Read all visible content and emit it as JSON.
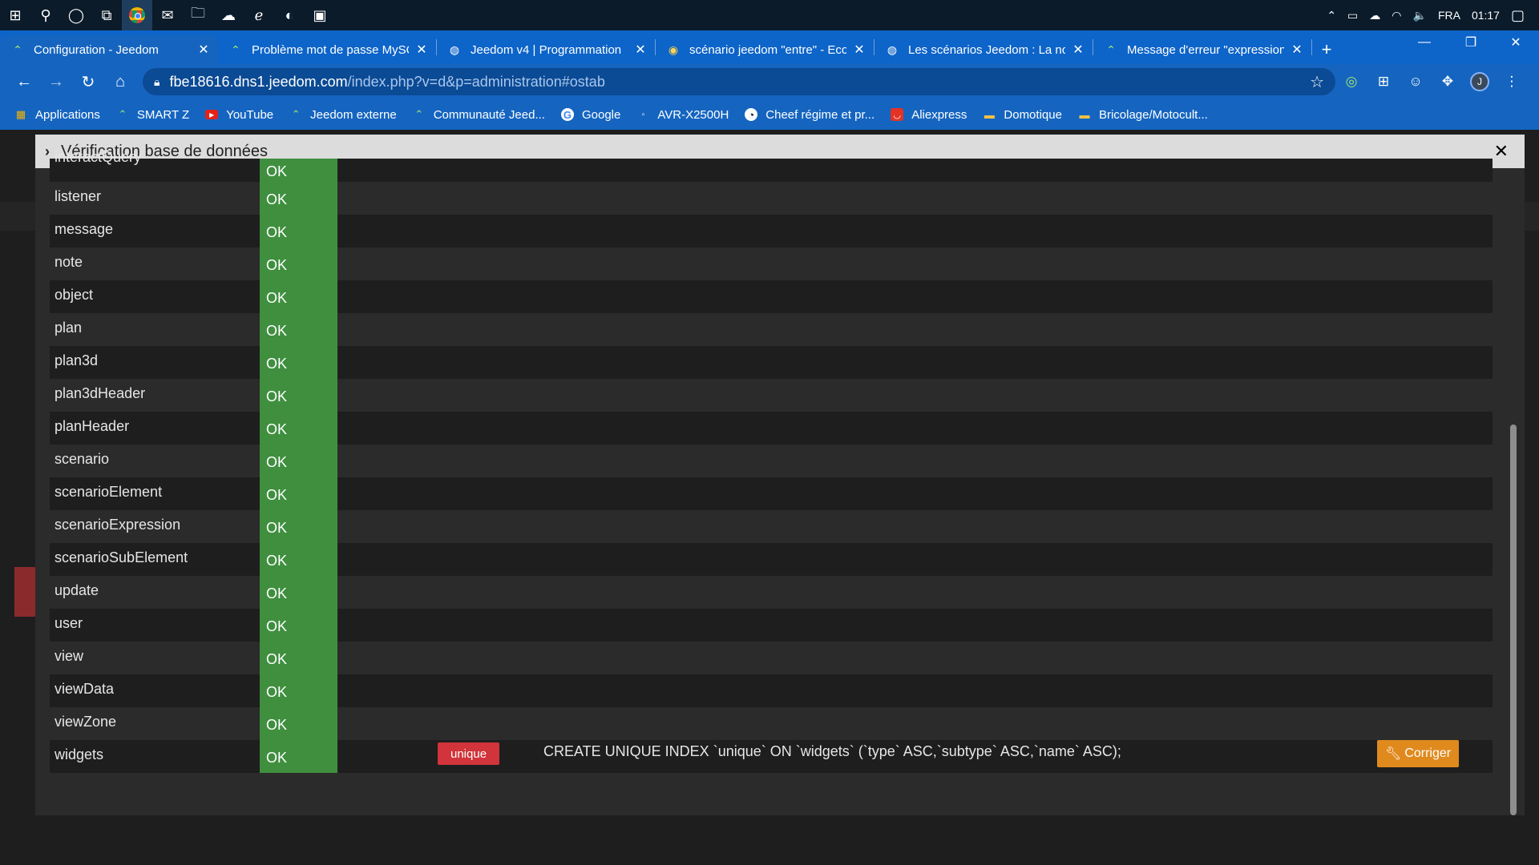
{
  "taskbar": {
    "tray": {
      "language": "FRA",
      "time": "01:17"
    }
  },
  "tabs": [
    {
      "title": "Configuration - Jeedom",
      "icon": "jeedom-icon",
      "active": true
    },
    {
      "title": "Problème mot de passe MySQL",
      "icon": "jeedom-icon"
    },
    {
      "title": "Jeedom v4 | Programmation",
      "icon": "globe-icon"
    },
    {
      "title": "scénario jeedom \"entre\" - Ecosia",
      "icon": "ecosia-icon"
    },
    {
      "title": "Les scénarios Jeedom : La nouvelle",
      "icon": "globe-icon"
    },
    {
      "title": "Message d'erreur \"expression\"",
      "icon": "jeedom-icon"
    }
  ],
  "address": {
    "host": "fbe18616.dns1.jeedom.com",
    "path": "/index.php?v=d&p=administration#ostab"
  },
  "bookmarks": [
    {
      "label": "Applications",
      "icon": "apps-grid-icon"
    },
    {
      "label": "SMART Z",
      "icon": "jeedom-icon"
    },
    {
      "label": "YouTube",
      "icon": "youtube-icon"
    },
    {
      "label": "Jeedom externe",
      "icon": "jeedom-icon"
    },
    {
      "label": "Communauté Jeed...",
      "icon": "jeedom-icon"
    },
    {
      "label": "Google",
      "icon": "google-icon"
    },
    {
      "label": "AVR-X2500H",
      "icon": "denon-icon"
    },
    {
      "label": "Cheef régime et pr...",
      "icon": "cheef-icon"
    },
    {
      "label": "Aliexpress",
      "icon": "aliexpress-icon"
    },
    {
      "label": "Domotique",
      "icon": "folder-icon"
    },
    {
      "label": "Bricolage/Motocult...",
      "icon": "folder-icon"
    }
  ],
  "modal": {
    "title": "Vérification base de données",
    "rows": [
      {
        "name": "interactQuery",
        "status": "OK"
      },
      {
        "name": "listener",
        "status": "OK"
      },
      {
        "name": "message",
        "status": "OK"
      },
      {
        "name": "note",
        "status": "OK"
      },
      {
        "name": "object",
        "status": "OK"
      },
      {
        "name": "plan",
        "status": "OK"
      },
      {
        "name": "plan3d",
        "status": "OK"
      },
      {
        "name": "plan3dHeader",
        "status": "OK"
      },
      {
        "name": "planHeader",
        "status": "OK"
      },
      {
        "name": "scenario",
        "status": "OK"
      },
      {
        "name": "scenarioElement",
        "status": "OK"
      },
      {
        "name": "scenarioExpression",
        "status": "OK"
      },
      {
        "name": "scenarioSubElement",
        "status": "OK"
      },
      {
        "name": "update",
        "status": "OK"
      },
      {
        "name": "user",
        "status": "OK"
      },
      {
        "name": "view",
        "status": "OK"
      },
      {
        "name": "viewData",
        "status": "OK"
      },
      {
        "name": "viewZone",
        "status": "OK"
      },
      {
        "name": "widgets",
        "status": "OK",
        "badge": "unique",
        "sql": "CREATE UNIQUE INDEX `unique` ON `widgets` (`type` ASC,`subtype` ASC,`name` ASC);",
        "fix_label": "Corriger"
      }
    ]
  },
  "colors": {
    "ok": "#3f8f3f",
    "error_badge": "#d1343a",
    "fix_button": "#e08a1e",
    "chrome_blue": "#1565c0"
  }
}
